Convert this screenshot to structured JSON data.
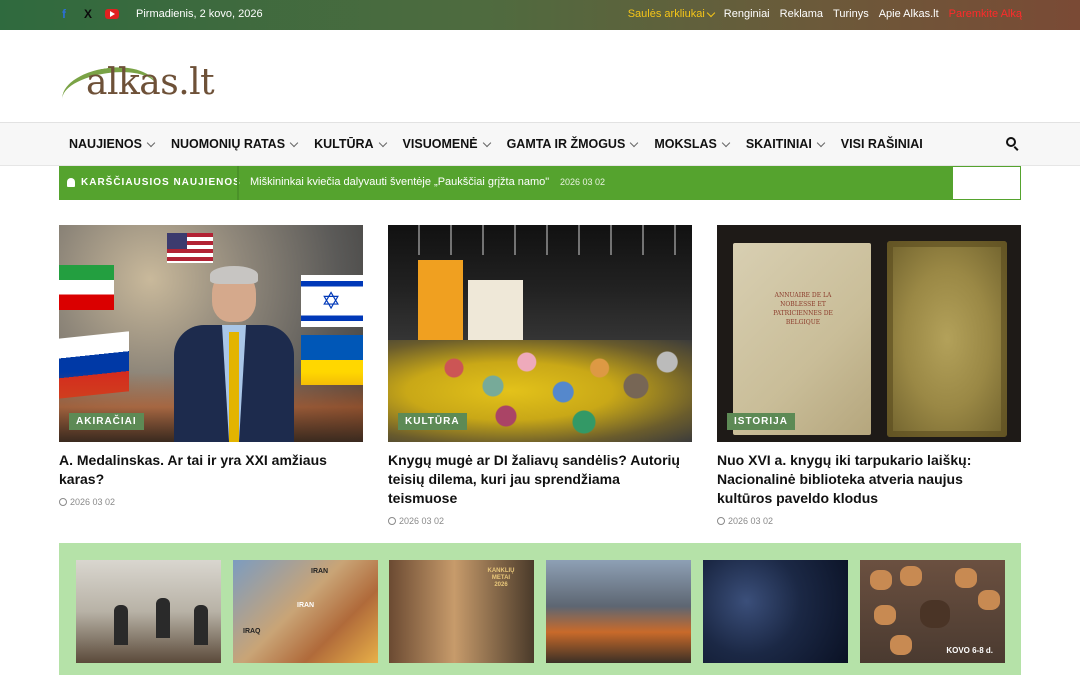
{
  "topbar": {
    "date": "Pirmadienis, 2 kovo, 2026",
    "social": [
      "facebook-icon",
      "x-icon",
      "youtube-icon"
    ],
    "links": [
      {
        "label": "Saulės arkliukai",
        "highlight": true,
        "dropdown": true
      },
      {
        "label": "Renginiai"
      },
      {
        "label": "Reklama"
      },
      {
        "label": "Turinys"
      },
      {
        "label": "Apie Alkas.lt"
      },
      {
        "label": "Paremkite Alką",
        "red": true
      }
    ]
  },
  "logo": {
    "text": "alkas.lt"
  },
  "nav": {
    "items": [
      {
        "label": "NAUJIENOS"
      },
      {
        "label": "NUOMONIŲ RATAS"
      },
      {
        "label": "KULTŪRA"
      },
      {
        "label": "VISUOMENĖ"
      },
      {
        "label": "GAMTA IR ŽMOGUS"
      },
      {
        "label": "MOKSLAS"
      },
      {
        "label": "SKAITINIAI"
      },
      {
        "label": "VISI RAŠINIAI"
      }
    ]
  },
  "ticker": {
    "label": "KARŠČIAUSIOS NAUJIENOS",
    "headline": "Miškininkai kviečia dalyvauti šventėje „Paukščiai grįžta namo\"",
    "date": "2026 03 02"
  },
  "featured": [
    {
      "tag": "AKIRAČIAI",
      "title": "A. Medalinskas. Ar tai ir yra XXI amžiaus karas?",
      "date": "2026 03 02"
    },
    {
      "tag": "KULTŪRA",
      "title": "Knygų mugė ar DI žaliavų sandėlis? Autorių teisių dilema, kuri jau sprendžiama teismuose",
      "date": "2026 03 02"
    },
    {
      "tag": "ISTORIJA",
      "title": "Nuo XVI a. knygų iki tarpukario laiškų: Nacionalinė biblioteka atveria naujus kultūros paveldo klodus",
      "date": "2026 03 02"
    }
  ],
  "book_text": "ANNUAIRE DE LA NOBLESSE ET PATRICIENNES DE BELGIQUE",
  "thumbs": {
    "t2_labels": [
      "IRAN",
      "IRAN",
      "IRAQ"
    ],
    "t3_caption": "KANKLIŲ METAI 2026",
    "t6_caption": "KOVO 6-8 d."
  },
  "colors": {
    "ticker": "#55a32e",
    "strip": "#b5e2a8",
    "tag": "#5d8a55",
    "logo_text": "#6e5138",
    "logo_arc": "#7aa346"
  }
}
